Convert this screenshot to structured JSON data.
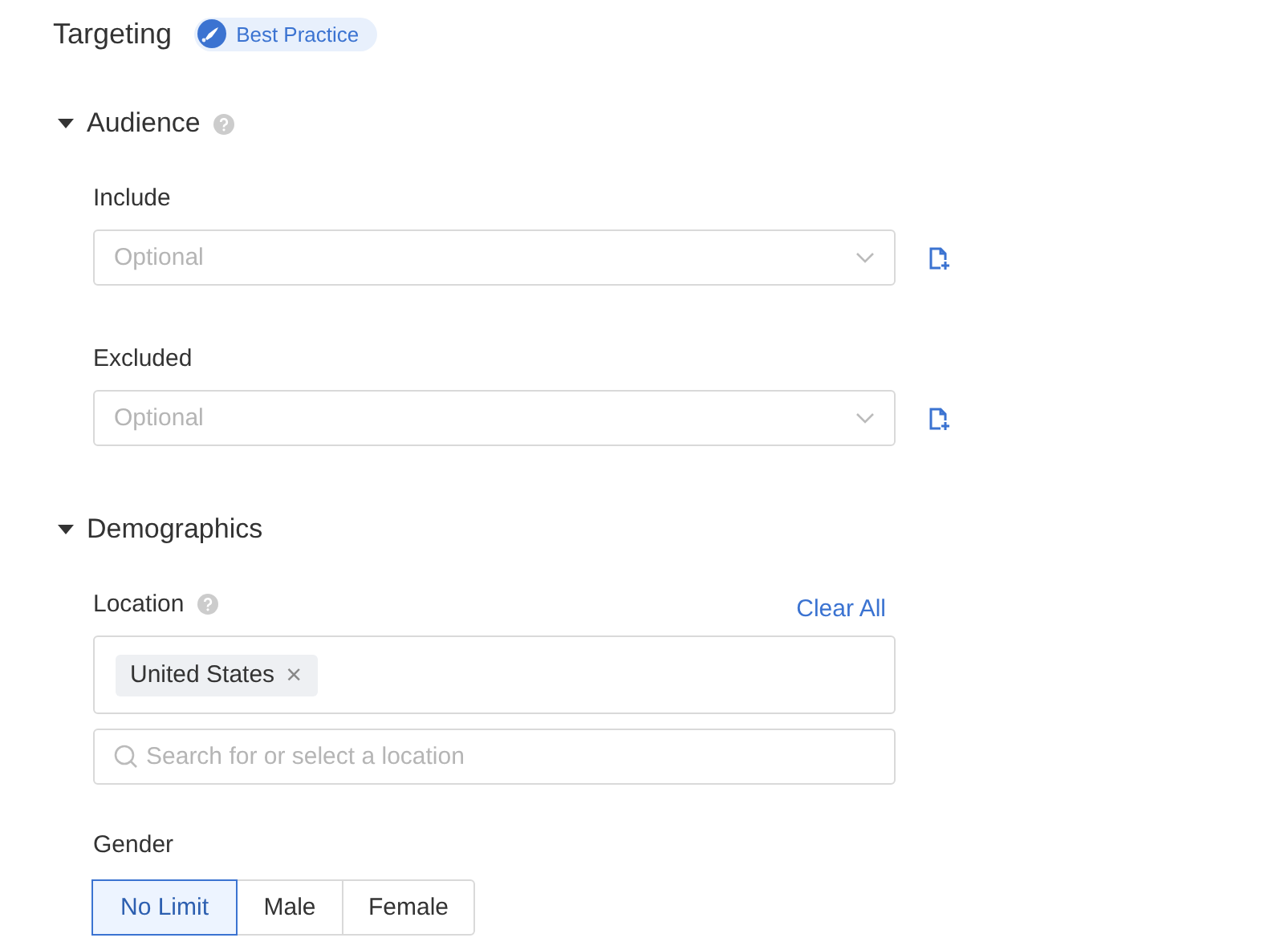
{
  "title": "Targeting",
  "badge": {
    "label": "Best Practice"
  },
  "sections": [
    {
      "title": "Audience",
      "expanded": true,
      "help": true,
      "fields": [
        {
          "kind": "select",
          "label": "Include",
          "placeholder": "Optional"
        },
        {
          "kind": "select",
          "label": "Excluded",
          "placeholder": "Optional"
        }
      ]
    },
    {
      "title": "Demographics",
      "expanded": true,
      "help": false,
      "fields": [
        {
          "kind": "location",
          "label": "Location",
          "help": true,
          "action": "Clear All",
          "tags": [
            {
              "label": "United States",
              "remove": "×"
            }
          ],
          "placeholder": "Search for or select a location"
        },
        {
          "kind": "segmented",
          "label": "Gender",
          "options": [
            {
              "label": "No Limit",
              "selected": true
            },
            {
              "label": "Male",
              "selected": false
            },
            {
              "label": "Female",
              "selected": false
            }
          ]
        }
      ]
    }
  ]
}
